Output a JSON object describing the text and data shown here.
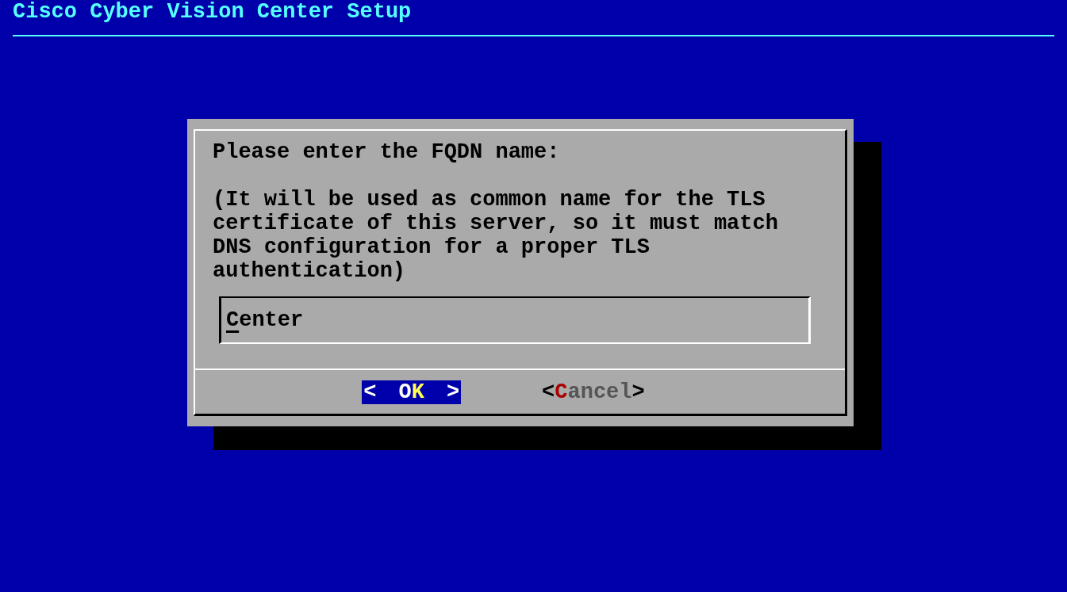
{
  "screen": {
    "title": "Cisco Cyber Vision Center Setup"
  },
  "dialog": {
    "prompt": "Please enter the FQDN name:",
    "description": "(It will be used as common name for the TLS certificate of this server, so it must match DNS configuration for a proper TLS authentication)",
    "input": {
      "value": "Center"
    },
    "buttons": [
      {
        "open": "<",
        "before": "O",
        "hotkey": "K",
        "close": ">",
        "selected": true
      },
      {
        "open": "<",
        "hotkey": "C",
        "after": "ancel",
        "close": ">",
        "selected": false
      }
    ]
  }
}
